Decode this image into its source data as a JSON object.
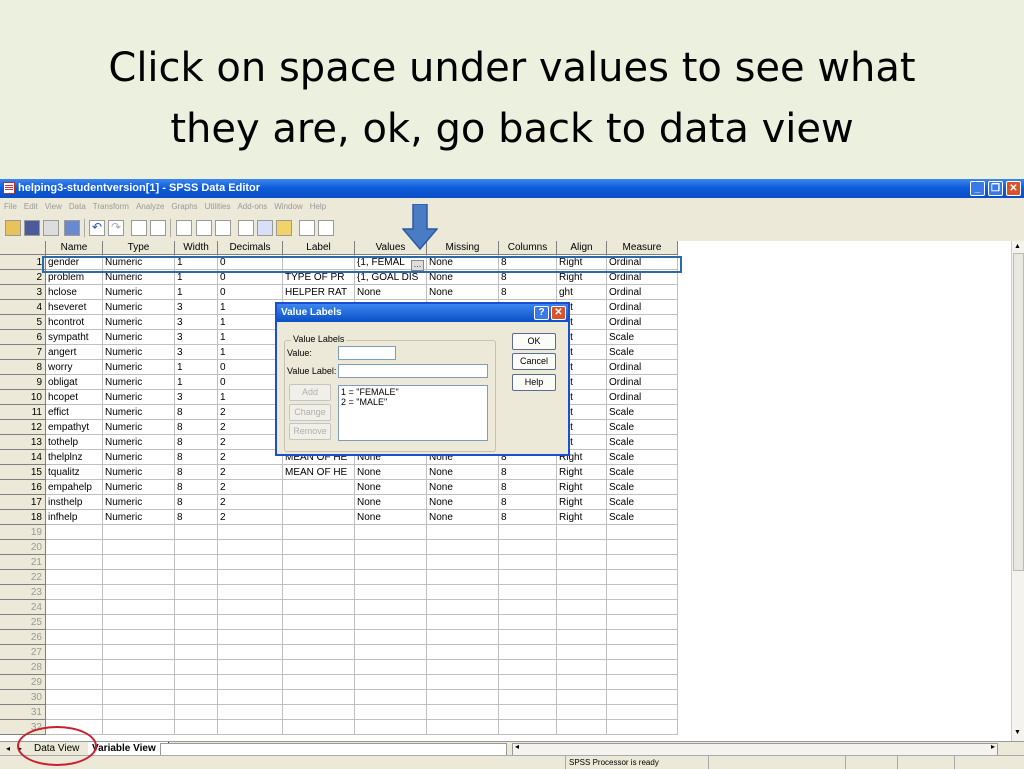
{
  "slide": {
    "title_line1": "Click on space under values to see what",
    "title_line2": "they are, ok,  go back to data view"
  },
  "window": {
    "title": "helping3-studentversion[1] - SPSS Data Editor",
    "menu": [
      "File",
      "Edit",
      "View",
      "Data",
      "Transform",
      "Analyze",
      "Graphs",
      "Utilities",
      "Add-ons",
      "Window",
      "Help"
    ]
  },
  "grid": {
    "columns": [
      "Name",
      "Type",
      "Width",
      "Decimals",
      "Label",
      "Values",
      "Missing",
      "Columns",
      "Align",
      "Measure"
    ],
    "rows": [
      [
        "gender",
        "Numeric",
        "1",
        "0",
        "",
        "{1, FEMAL",
        "None",
        "8",
        "Right",
        "Ordinal"
      ],
      [
        "problem",
        "Numeric",
        "1",
        "0",
        "TYPE OF PR",
        "{1, GOAL DIS",
        "None",
        "8",
        "Right",
        "Ordinal"
      ],
      [
        "hclose",
        "Numeric",
        "1",
        "0",
        "HELPER RAT",
        "None",
        "None",
        "8",
        "ght",
        "Ordinal"
      ],
      [
        "hseveret",
        "Numeric",
        "3",
        "1",
        "",
        "",
        "",
        "",
        "ght",
        "Ordinal"
      ],
      [
        "hcontrot",
        "Numeric",
        "3",
        "1",
        "",
        "",
        "",
        "",
        "ght",
        "Ordinal"
      ],
      [
        "sympatht",
        "Numeric",
        "3",
        "1",
        "",
        "",
        "",
        "",
        "ght",
        "Scale"
      ],
      [
        "angert",
        "Numeric",
        "3",
        "1",
        "",
        "",
        "",
        "",
        "ght",
        "Scale"
      ],
      [
        "worry",
        "Numeric",
        "1",
        "0",
        "",
        "",
        "",
        "",
        "ght",
        "Ordinal"
      ],
      [
        "obligat",
        "Numeric",
        "1",
        "0",
        "",
        "",
        "",
        "",
        "ght",
        "Ordinal"
      ],
      [
        "hcopet",
        "Numeric",
        "3",
        "1",
        "",
        "",
        "",
        "",
        "ght",
        "Ordinal"
      ],
      [
        "effict",
        "Numeric",
        "8",
        "2",
        "",
        "",
        "",
        "",
        "ght",
        "Scale"
      ],
      [
        "empathyt",
        "Numeric",
        "8",
        "2",
        "",
        "",
        "",
        "",
        "ght",
        "Scale"
      ],
      [
        "tothelp",
        "Numeric",
        "8",
        "2",
        "",
        "",
        "",
        "",
        "ght",
        "Scale"
      ],
      [
        "thelplnz",
        "Numeric",
        "8",
        "2",
        "MEAN OF HE",
        "None",
        "None",
        "8",
        "Right",
        "Scale"
      ],
      [
        "tqualitz",
        "Numeric",
        "8",
        "2",
        "MEAN OF HE",
        "None",
        "None",
        "8",
        "Right",
        "Scale"
      ],
      [
        "empahelp",
        "Numeric",
        "8",
        "2",
        "",
        "None",
        "None",
        "8",
        "Right",
        "Scale"
      ],
      [
        "insthelp",
        "Numeric",
        "8",
        "2",
        "",
        "None",
        "None",
        "8",
        "Right",
        "Scale"
      ],
      [
        "infhelp",
        "Numeric",
        "8",
        "2",
        "",
        "None",
        "None",
        "8",
        "Right",
        "Scale"
      ]
    ],
    "row_numbers": [
      "1",
      "2",
      "3",
      "4",
      "5",
      "6",
      "7",
      "8",
      "9",
      "10",
      "11",
      "12",
      "13",
      "14",
      "15",
      "16",
      "17",
      "18",
      "19",
      "20",
      "21",
      "22",
      "23",
      "24",
      "25",
      "26",
      "27",
      "28",
      "29",
      "30",
      "31",
      "32"
    ]
  },
  "dialog": {
    "title": "Value Labels",
    "group_legend": "Value Labels",
    "value_label": "Value:",
    "value_label_label": "Value Label:",
    "add": "Add",
    "change": "Change",
    "remove": "Remove",
    "ok": "OK",
    "cancel": "Cancel",
    "help": "Help",
    "list": [
      "1 = \"FEMALE\"",
      "2 = \"MALE\""
    ],
    "help_glyph": "?",
    "close_glyph": "✕"
  },
  "tabs": {
    "data_view": "Data View",
    "variable_view": "Variable View"
  },
  "status": {
    "processor": "SPSS Processor  is ready"
  },
  "colors": {
    "slide_bg": "#ebf1de",
    "annotation_blue": "#2b6aaa",
    "annotation_red": "#c8202f",
    "arrow": "#4a7cc4"
  }
}
